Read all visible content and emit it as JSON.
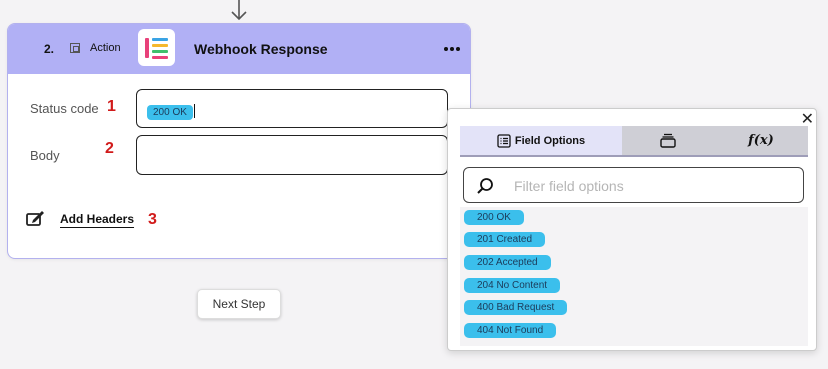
{
  "card": {
    "step_number": "2.",
    "step_kind": "Action",
    "title": "Webhook Response",
    "fields": [
      {
        "label": "Status code",
        "annotation": "1",
        "value": "200 OK"
      },
      {
        "label": "Body",
        "annotation": "2",
        "value": ""
      }
    ],
    "add_headers_label": "Add Headers",
    "add_headers_annotation": "3"
  },
  "next_step_label": "Next Step",
  "popup": {
    "tabs": [
      {
        "label": "Field Options",
        "icon": "list-icon",
        "active": true
      },
      {
        "label": "",
        "icon": "layers-icon",
        "active": false
      },
      {
        "label": "f(x)",
        "icon": "function-icon",
        "active": false
      }
    ],
    "search_placeholder": "Filter field options",
    "options": [
      "200 OK",
      "201 Created",
      "202 Accepted",
      "204 No Content",
      "400 Bad Request",
      "404 Not Found"
    ]
  },
  "colors": {
    "header_bg": "#b1b0f5",
    "pill": "#3bbfec",
    "annotation": "#d11a1a",
    "active_tab": "#e3e3f8"
  }
}
